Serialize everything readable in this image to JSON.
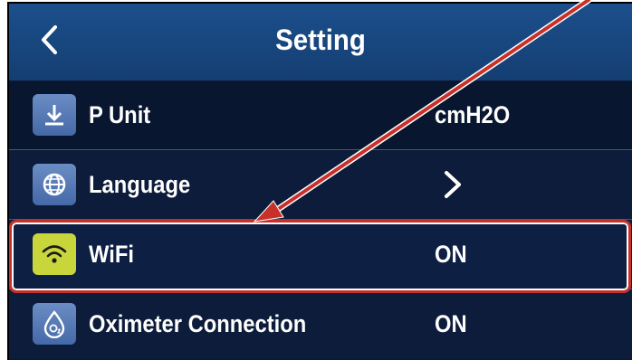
{
  "header": {
    "title": "Setting",
    "back_icon": "chevron-left-icon"
  },
  "settings": [
    {
      "label": "P Unit",
      "value": "cmH2O",
      "icon": "download-icon"
    },
    {
      "label": "Language",
      "value": "",
      "icon": "globe-icon",
      "value_icon": "chevron-right-icon"
    },
    {
      "label": "WiFi",
      "value": "ON",
      "icon": "wifi-icon",
      "highlighted": true
    },
    {
      "label": "Oximeter Connection",
      "value": "ON",
      "icon": "o2-drop-icon"
    }
  ],
  "annotation": {
    "color": "#c8312a",
    "type": "arrow-pointing-to-wifi-row"
  },
  "colors": {
    "header_bg": "#1c4f8c",
    "row_bg": "#081630",
    "wifi_icon_bg": "#c9d63b",
    "annotation": "#c8312a"
  }
}
